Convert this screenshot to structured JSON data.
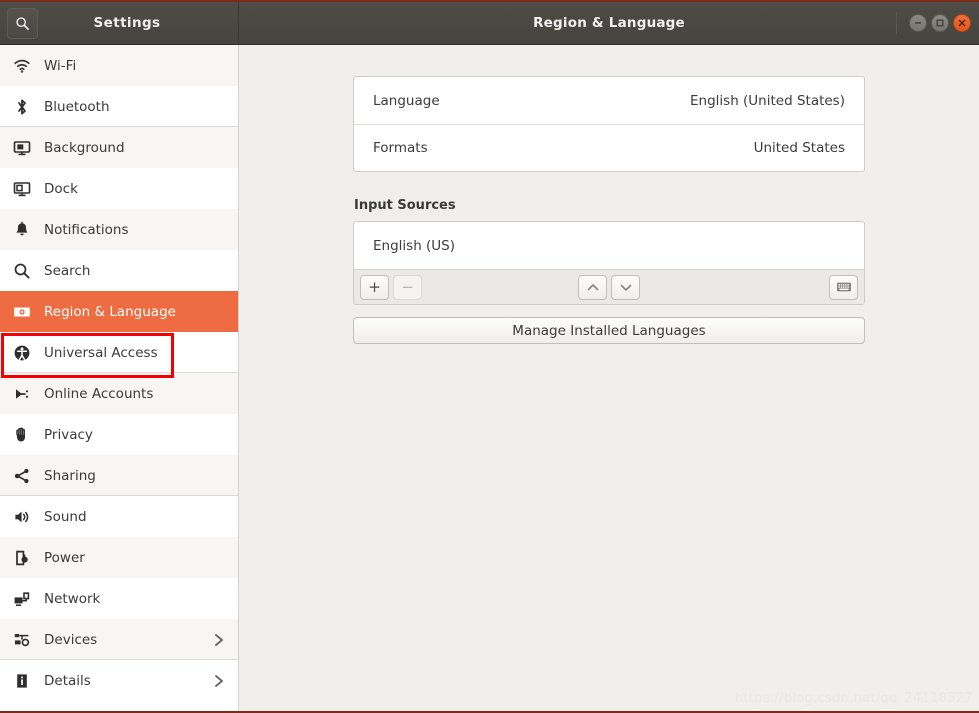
{
  "window": {
    "app_title": "Settings",
    "page_title": "Region & Language",
    "search_icon": "search-icon",
    "controls": {
      "minimize": "minimize-icon",
      "maximize": "maximize-icon",
      "close": "close-icon"
    },
    "accent_color": "#ef6c42",
    "titlebar_color": "#4a4843",
    "annotation_color": "#f40000"
  },
  "sidebar": {
    "items": [
      {
        "label": "Wi-Fi",
        "icon": "wifi-icon",
        "selected": false,
        "chevron": false
      },
      {
        "label": "Bluetooth",
        "icon": "bluetooth-icon",
        "selected": false,
        "chevron": false
      },
      {
        "label": "Background",
        "icon": "background-icon",
        "selected": false,
        "chevron": false
      },
      {
        "label": "Dock",
        "icon": "dock-icon",
        "selected": false,
        "chevron": false
      },
      {
        "label": "Notifications",
        "icon": "bell-icon",
        "selected": false,
        "chevron": false
      },
      {
        "label": "Search",
        "icon": "search-icon",
        "selected": false,
        "chevron": false
      },
      {
        "label": "Region & Language",
        "icon": "region-language-icon",
        "selected": true,
        "chevron": false
      },
      {
        "label": "Universal Access",
        "icon": "accessibility-icon",
        "selected": false,
        "chevron": false
      },
      {
        "label": "Online Accounts",
        "icon": "online-accounts-icon",
        "selected": false,
        "chevron": false
      },
      {
        "label": "Privacy",
        "icon": "hand-icon",
        "selected": false,
        "chevron": false
      },
      {
        "label": "Sharing",
        "icon": "share-icon",
        "selected": false,
        "chevron": false
      },
      {
        "label": "Sound",
        "icon": "speaker-icon",
        "selected": false,
        "chevron": false
      },
      {
        "label": "Power",
        "icon": "power-icon",
        "selected": false,
        "chevron": false
      },
      {
        "label": "Network",
        "icon": "network-icon",
        "selected": false,
        "chevron": false
      },
      {
        "label": "Devices",
        "icon": "devices-icon",
        "selected": false,
        "chevron": true
      },
      {
        "label": "Details",
        "icon": "info-icon",
        "selected": false,
        "chevron": true
      }
    ]
  },
  "main": {
    "language_rows": [
      {
        "label": "Language",
        "value": "English (United States)"
      },
      {
        "label": "Formats",
        "value": "United States"
      }
    ],
    "input_sources": {
      "heading": "Input Sources",
      "items": [
        "English (US)"
      ],
      "toolbar": {
        "add_label": "+",
        "remove_label": "−",
        "move_up_icon": "chevron-up-icon",
        "move_down_icon": "chevron-down-icon",
        "keyboard_icon": "keyboard-icon",
        "add_enabled": true,
        "remove_enabled": false
      }
    },
    "manage_languages_label": "Manage Installed Languages"
  },
  "overlay": {
    "watermark": "https://blog.csdn.net/qq_24118527"
  }
}
